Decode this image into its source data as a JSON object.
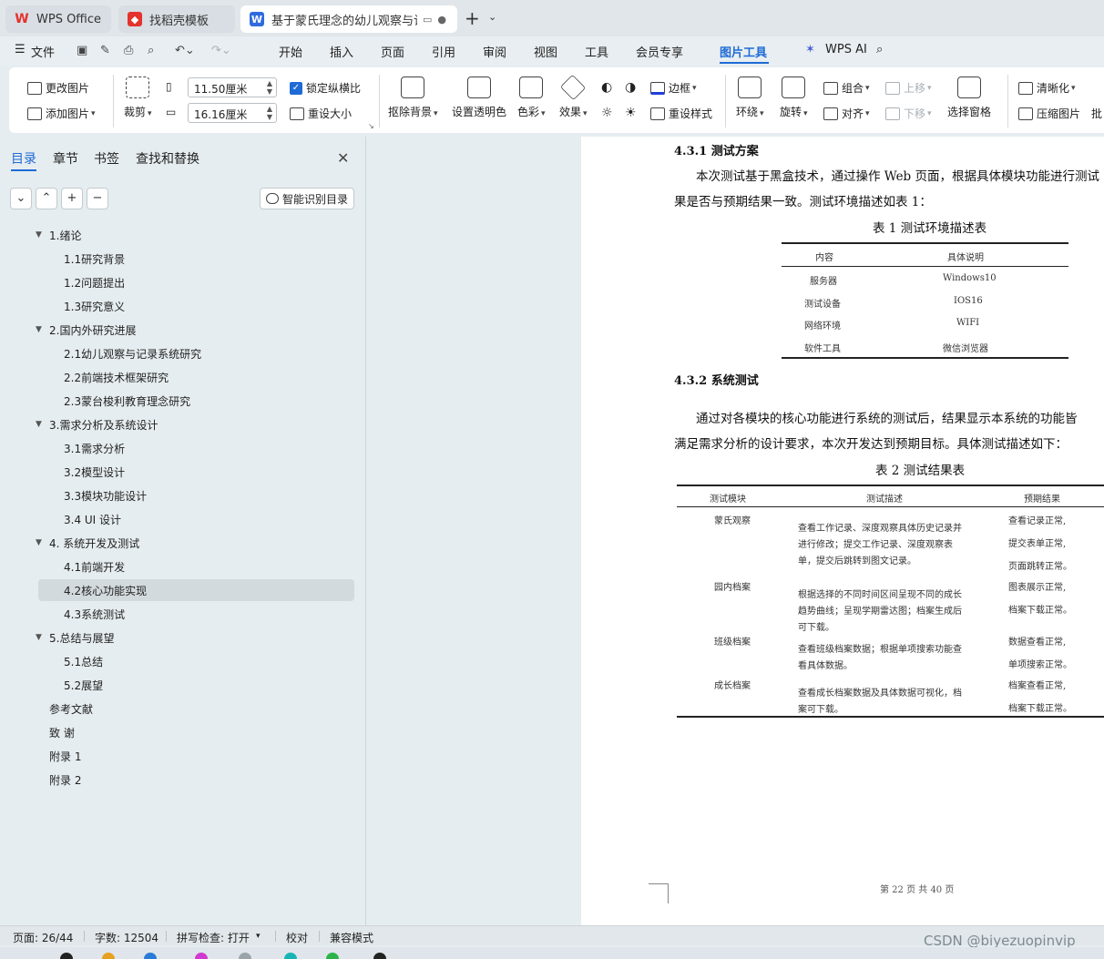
{
  "tabs": [
    {
      "label": "WPS Office",
      "icon": "wps-logo-icon",
      "color": "#e5322d"
    },
    {
      "label": "找稻壳模板",
      "icon": "docer-icon",
      "color": "#e5322d"
    },
    {
      "label": "基于蒙氏理念的幼儿观察与记录",
      "icon": "writer-doc-icon",
      "color": "#2f6bdf"
    }
  ],
  "menu": {
    "file": "文件",
    "items": [
      "开始",
      "插入",
      "页面",
      "引用",
      "审阅",
      "视图",
      "工具",
      "会员专享",
      "图片工具"
    ],
    "active": "图片工具",
    "wps_ai": "WPS AI"
  },
  "ribbon": {
    "change_image": "更改图片",
    "add_image": "添加图片",
    "crop": "裁剪",
    "width_value": "11.50厘米",
    "height_value": "16.16厘米",
    "lock_ratio": "锁定纵横比",
    "reset_size": "重设大小",
    "remove_bg": "抠除背景",
    "set_transparent": "设置透明色",
    "color": "色彩",
    "effect": "效果",
    "border": "边框",
    "reset_style": "重设样式",
    "wrap": "环绕",
    "rotate": "旋转",
    "group": "组合",
    "align": "对齐",
    "move_up": "上移",
    "move_down": "下移",
    "select_pane": "选择窗格",
    "sharpen": "清晰化",
    "compress": "压缩图片",
    "batch": "批"
  },
  "panel": {
    "tabs": [
      "目录",
      "章节",
      "书签",
      "查找和替换"
    ],
    "smart_button": "智能识别目录",
    "toc": [
      {
        "label": "1.绪论",
        "level": 1,
        "expanded": true
      },
      {
        "label": "1.1研究背景",
        "level": 2
      },
      {
        "label": "1.2问题提出",
        "level": 2
      },
      {
        "label": "1.3研究意义",
        "level": 2
      },
      {
        "label": "2.国内外研究进展",
        "level": 1,
        "expanded": true
      },
      {
        "label": "2.1幼儿观察与记录系统研究",
        "level": 2
      },
      {
        "label": "2.2前端技术框架研究",
        "level": 2
      },
      {
        "label": "2.3蒙台梭利教育理念研究",
        "level": 2
      },
      {
        "label": "3.需求分析及系统设计",
        "level": 1,
        "expanded": true
      },
      {
        "label": "3.1需求分析",
        "level": 2
      },
      {
        "label": "3.2模型设计",
        "level": 2
      },
      {
        "label": "3.3模块功能设计",
        "level": 2
      },
      {
        "label": "3.4 UI 设计",
        "level": 2
      },
      {
        "label": "4.  系统开发及测试",
        "level": 1,
        "expanded": true
      },
      {
        "label": "4.1前端开发",
        "level": 2
      },
      {
        "label": "4.2核心功能实现",
        "level": 2,
        "selected": true
      },
      {
        "label": "4.3系统测试",
        "level": 2
      },
      {
        "label": "5.总结与展望",
        "level": 1,
        "expanded": true
      },
      {
        "label": "5.1总结",
        "level": 2
      },
      {
        "label": "5.2展望",
        "level": 2
      },
      {
        "label": "参考文献",
        "level": 1
      },
      {
        "label": "致 谢",
        "level": 1
      },
      {
        "label": "附录 1",
        "level": 1
      },
      {
        "label": "附录 2",
        "level": 1
      }
    ]
  },
  "document": {
    "heading1": "4.3.1 测试方案",
    "para1_line1": "本次测试基于黑盒技术，通过操作 Web 页面，根据具体模块功能进行测试",
    "para1_line2": "果是否与预期结果一致。测试环境描述如表 1：",
    "table1_caption": "表 1  测试环境描述表",
    "table1_header": [
      "内容",
      "具体说明"
    ],
    "table1_rows": [
      [
        "服务器",
        "Windows10"
      ],
      [
        "测试设备",
        "IOS16"
      ],
      [
        "网络环境",
        "WIFI"
      ],
      [
        "软件工具",
        "微信浏览器"
      ]
    ],
    "heading2": "4.3.2 系统测试",
    "para2_line1": "通过对各模块的核心功能进行系统的测试后，结果显示本系统的功能皆",
    "para2_line2": "满足需求分析的设计要求，本次开发达到预期目标。具体测试描述如下：",
    "table2_caption": "表 2 测试结果表",
    "table2_header": [
      "测试模块",
      "测试描述",
      "预期结果"
    ],
    "table2_rows": [
      {
        "module": "蒙氏观察",
        "desc": [
          "查看工作记录、深度观察具体历史记录并",
          "进行修改；提交工作记录、深度观察表",
          "单，提交后跳转到图文记录。"
        ],
        "result": [
          "查看记录正常,",
          "提交表单正常,",
          "页面跳转正常。"
        ]
      },
      {
        "module": "园内档案",
        "desc": [
          "根据选择的不同时间区间呈现不同的成长",
          "趋势曲线；呈现学期雷达图；档案生成后",
          "可下载。"
        ],
        "result": [
          "图表展示正常,",
          "档案下载正常。"
        ]
      },
      {
        "module": "班级档案",
        "desc": [
          "查看班级档案数据；根据单项搜索功能查",
          "看具体数据。"
        ],
        "result": [
          "数据查看正常,",
          "单项搜索正常。"
        ]
      },
      {
        "module": "成长档案",
        "desc": [
          "查看成长档案数据及具体数据可视化，档",
          "案可下载。"
        ],
        "result": [
          "档案查看正常,",
          "档案下载正常。"
        ]
      }
    ],
    "footer": "第 22 页  共 40 页"
  },
  "status": {
    "page": "页面: 26/44",
    "words": "字数: 12504",
    "spell": "拼写检查: 打开",
    "proof": "校对",
    "compat": "兼容模式"
  },
  "watermark": "CSDN @biyezuopinvip"
}
